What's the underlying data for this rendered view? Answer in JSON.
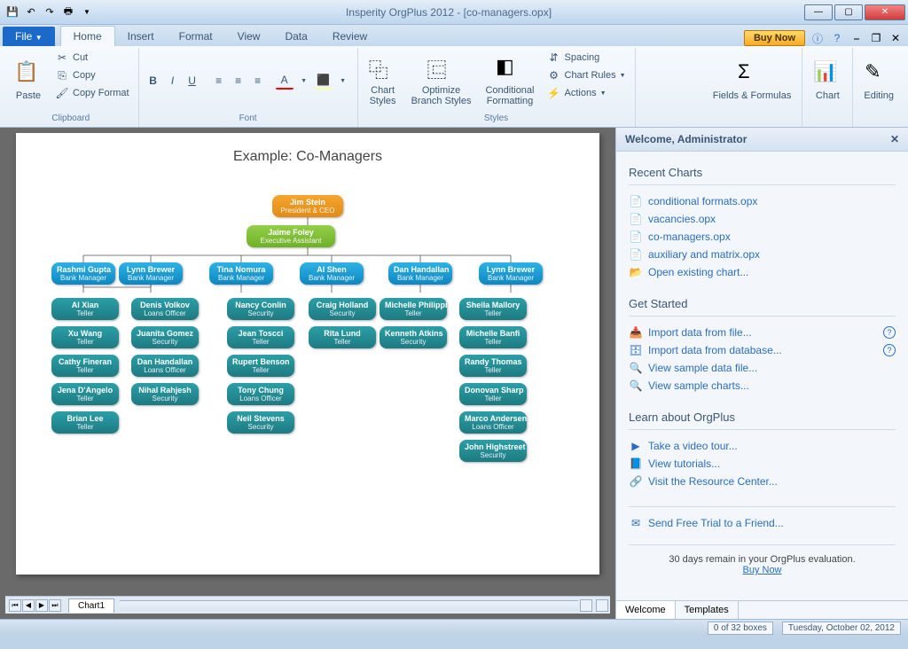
{
  "title": "Insperity OrgPlus 2012 - [co-managers.opx]",
  "qat": [
    "save-icon",
    "undo-icon",
    "redo-icon",
    "print-icon"
  ],
  "tabs": {
    "file": "File",
    "home": "Home",
    "insert": "Insert",
    "format": "Format",
    "view": "View",
    "data": "Data",
    "review": "Review"
  },
  "buynow": "Buy Now",
  "ribbon": {
    "paste": "Paste",
    "cut": "Cut",
    "copy": "Copy",
    "copyformat": "Copy Format",
    "clipboard": "Clipboard",
    "font": "Font",
    "chartstyles": "Chart\nStyles",
    "optimize": "Optimize\nBranch Styles",
    "conditional": "Conditional\nFormatting",
    "styles": "Styles",
    "spacing": "Spacing",
    "chartrules": "Chart Rules",
    "actions": "Actions",
    "fields": "Fields & Formulas",
    "chart": "Chart",
    "editing": "Editing"
  },
  "chart_title": "Example: Co-Managers",
  "chart_data": {
    "type": "org",
    "root": {
      "name": "Jim Stein",
      "title": "President & CEO",
      "color": "orange"
    },
    "assistant": {
      "name": "Jaime Foley",
      "title": "Executive Assistant",
      "color": "green"
    },
    "managers": [
      {
        "name": "Rashmi Gupta",
        "title": "Bank Manager",
        "reports": [
          {
            "name": "AI Xian",
            "title": "Teller"
          },
          {
            "name": "Xu Wang",
            "title": "Teller"
          },
          {
            "name": "Cathy Fineran",
            "title": "Teller"
          },
          {
            "name": "Jena D'Angelo",
            "title": "Teller"
          },
          {
            "name": "Brian Lee",
            "title": "Teller"
          }
        ]
      },
      {
        "name": "Lynn Brewer",
        "title": "Bank Manager",
        "reports": [
          {
            "name": "Denis Volkov",
            "title": "Loans Officer"
          },
          {
            "name": "Juanita Gomez",
            "title": "Security"
          },
          {
            "name": "Dan Handallan",
            "title": "Loans Officer"
          },
          {
            "name": "Nihal Rahjesh",
            "title": "Security"
          }
        ]
      },
      {
        "name": "Tina Nomura",
        "title": "Bank Manager",
        "reports": [
          {
            "name": "Nancy Conlin",
            "title": "Security"
          },
          {
            "name": "Jean Toscci",
            "title": "Teller"
          },
          {
            "name": "Rupert Benson",
            "title": "Teller"
          },
          {
            "name": "Tony Chung",
            "title": "Loans Officer"
          },
          {
            "name": "Neil Stevens",
            "title": "Security"
          }
        ]
      },
      {
        "name": "Al Shen",
        "title": "Bank Manager",
        "reports": [
          {
            "name": "Craig Holland",
            "title": "Security"
          },
          {
            "name": "Rita Lund",
            "title": "Teller"
          }
        ]
      },
      {
        "name": "Dan Handallan",
        "title": "Bank Manager",
        "reports": [
          {
            "name": "Michelle Philippi",
            "title": "Teller"
          },
          {
            "name": "Kenneth Atkins",
            "title": "Security"
          }
        ]
      },
      {
        "name": "Lynn Brewer",
        "title": "Bank Manager",
        "reports": [
          {
            "name": "Sheila Mallory",
            "title": "Teller"
          },
          {
            "name": "Michelle Banfi",
            "title": "Teller"
          },
          {
            "name": "Randy Thomas",
            "title": "Teller"
          },
          {
            "name": "Donovan Sharp",
            "title": "Teller"
          },
          {
            "name": "Marco Andersen",
            "title": "Loans Officer"
          },
          {
            "name": "John Highstreet",
            "title": "Security"
          }
        ]
      }
    ]
  },
  "sidepanel": {
    "header": "Welcome, Administrator",
    "recent_title": "Recent Charts",
    "recent": [
      "conditional formats.opx",
      "vacancies.opx",
      "co-managers.opx",
      "auxiliary and matrix.opx"
    ],
    "open": "Open existing chart...",
    "getstarted_title": "Get Started",
    "getstarted": [
      "Import data from file...",
      "Import data from database...",
      "View sample data file...",
      "View sample charts..."
    ],
    "learn_title": "Learn about OrgPlus",
    "learn": [
      "Take a video tour...",
      "View tutorials...",
      "Visit the Resource Center..."
    ],
    "sendtrial": "Send Free Trial to a Friend...",
    "trial_msg": "30 days remain in your OrgPlus evaluation.",
    "trial_link": "Buy Now",
    "tabs": [
      "Welcome",
      "Templates"
    ]
  },
  "sheet": {
    "tab": "Chart1"
  },
  "status": {
    "boxes": "0 of 32 boxes",
    "date": "Tuesday, October 02, 2012"
  }
}
